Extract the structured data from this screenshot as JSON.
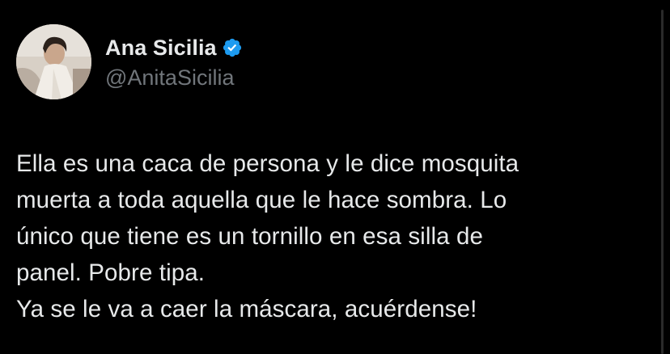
{
  "author": {
    "display_name": "Ana Sicilia",
    "handle": "@AnitaSicilia",
    "verified": true,
    "verified_icon": "verified-badge-icon",
    "verified_color": "#1d9bf0"
  },
  "tweet": {
    "text": "Ella es una caca de persona y le dice mosquita\nmuerta a toda aquella que le hace sombra. Lo\núnico que tiene es un tornillo en esa silla de\npanel. Pobre tipa.\nYa se le va a caer la máscara, acuérdense!"
  },
  "colors": {
    "background": "#000000",
    "text_primary": "#e7e9ea",
    "text_secondary": "#71767b"
  }
}
